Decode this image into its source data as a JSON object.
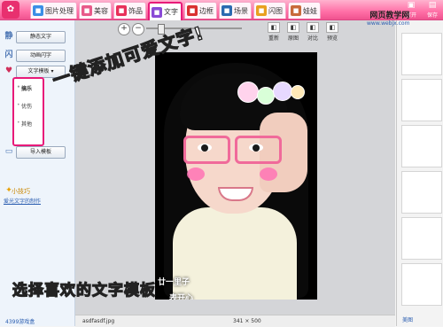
{
  "app": {
    "logo_text": "✿"
  },
  "tabs": [
    {
      "label": "图片处理",
      "icon": "photo-icon",
      "color": "#3a8ee6"
    },
    {
      "label": "美容",
      "icon": "face-icon",
      "color": "#e85a8a"
    },
    {
      "label": "饰品",
      "icon": "heart-icon",
      "color": "#e8305a"
    },
    {
      "label": "文字",
      "icon": "text-icon",
      "color": "#8a4ad6"
    },
    {
      "label": "边框",
      "icon": "frame-icon",
      "color": "#d93030"
    },
    {
      "label": "场景",
      "icon": "scene-icon",
      "color": "#2a6ab0"
    },
    {
      "label": "闪图",
      "icon": "flash-icon",
      "color": "#e8a020"
    },
    {
      "label": "娃娃",
      "icon": "doll-icon",
      "color": "#c86a3a"
    }
  ],
  "topright": {
    "open_label": "打开",
    "save_label": "保存"
  },
  "left_panel": {
    "static_text_btn": "静态文字",
    "anim_text_btn": "动画闪字",
    "text_template_btn": "文字模板",
    "categories": [
      "搞乐",
      "优伤",
      "其他"
    ],
    "import_btn": "导入模板",
    "tip_title": "小技巧",
    "tip_link": "爱光文字的制作",
    "bottom_link": "4399游戏盒"
  },
  "canvas_toolbar": {
    "zoom": 0.12,
    "tools": [
      {
        "label": "重新",
        "icon": "undo-icon"
      },
      {
        "label": "原图",
        "icon": "original-icon"
      },
      {
        "label": "对比",
        "icon": "compare-icon"
      },
      {
        "label": "预览",
        "icon": "preview-icon"
      }
    ]
  },
  "captions": {
    "main": "一键添加可爱文字!",
    "bottom": "选择喜欢的文字模板"
  },
  "photo_text": {
    "line1": "廿一里子",
    "line2": "表开心"
  },
  "status": {
    "filename": "asdfasdf.jpg",
    "dimensions": "341 × 500"
  },
  "watermark": {
    "line1": "网页教学网",
    "line2": "www.webjx.com"
  },
  "right_panel": {
    "bottom_link": "美图"
  }
}
